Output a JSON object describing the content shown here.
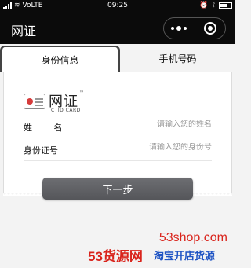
{
  "status_bar": {
    "network_label": "VoLTE",
    "time": "09:25"
  },
  "nav": {
    "title": "网证",
    "menu_icon": "more-dots-icon",
    "close_icon": "capsule-home-icon"
  },
  "tabs": [
    {
      "label": "身份信息",
      "active": true
    },
    {
      "label": "手机号码",
      "active": false
    }
  ],
  "logo": {
    "brand": "网证",
    "trademark": "™",
    "subtitle": "CTID CARD"
  },
  "form": {
    "name_label": "姓 名",
    "name_placeholder": "请输入您的姓名",
    "id_label": "身份证号",
    "id_placeholder": "请输入您的身份号"
  },
  "next_button": "下一步",
  "watermark": {
    "domain": "53shop.com",
    "brand": "53货源网",
    "slogan": "淘宝开店货源"
  },
  "colors": {
    "header_bg": "#0b0b0b",
    "button_bg": "#5f6064",
    "watermark_red": "#d9241c",
    "watermark_blue": "#1f54c4"
  }
}
